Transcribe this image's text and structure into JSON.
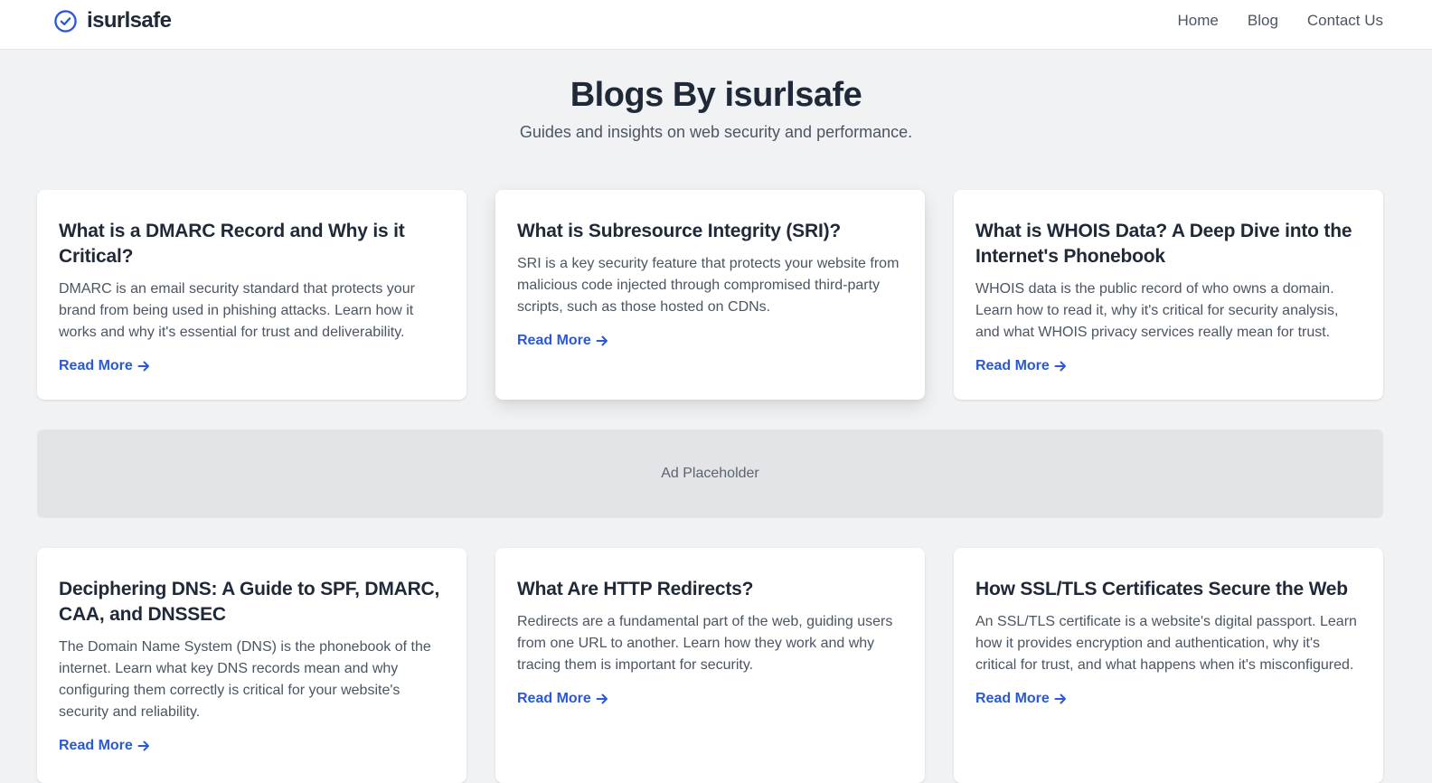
{
  "brand": {
    "name": "isurlsafe",
    "icon": "check-circle-icon",
    "accent": "#2b59d4"
  },
  "nav": {
    "items": [
      {
        "label": "Home"
      },
      {
        "label": "Blog"
      },
      {
        "label": "Contact Us"
      }
    ]
  },
  "hero": {
    "title": "Blogs By isurlsafe",
    "subtitle": "Guides and insights on web security and performance."
  },
  "ad": {
    "label": "Ad Placeholder"
  },
  "posts": [
    {
      "title": "What is a DMARC Record and Why is it Critical?",
      "excerpt": "DMARC is an email security standard that protects your brand from being used in phishing attacks. Learn how it works and why it's essential for trust and deliverability.",
      "cta": "Read More"
    },
    {
      "title": "What is Subresource Integrity (SRI)?",
      "excerpt": "SRI is a key security feature that protects your website from malicious code injected through compromised third-party scripts, such as those hosted on CDNs.",
      "cta": "Read More"
    },
    {
      "title": "What is WHOIS Data? A Deep Dive into the Internet's Phonebook",
      "excerpt": "WHOIS data is the public record of who owns a domain. Learn how to read it, why it's critical for security analysis, and what WHOIS privacy services really mean for trust.",
      "cta": "Read More"
    },
    {
      "title": "Deciphering DNS: A Guide to SPF, DMARC, CAA, and DNSSEC",
      "excerpt": "The Domain Name System (DNS) is the phonebook of the internet. Learn what key DNS records mean and why configuring them correctly is critical for your website's security and reliability.",
      "cta": "Read More"
    },
    {
      "title": "What Are HTTP Redirects?",
      "excerpt": "Redirects are a fundamental part of the web, guiding users from one URL to another. Learn how they work and why tracing them is important for security.",
      "cta": "Read More"
    },
    {
      "title": "How SSL/TLS Certificates Secure the Web",
      "excerpt": "An SSL/TLS certificate is a website's digital passport. Learn how it provides encryption and authentication, why it's critical for trust, and what happens when it's misconfigured.",
      "cta": "Read More"
    }
  ]
}
